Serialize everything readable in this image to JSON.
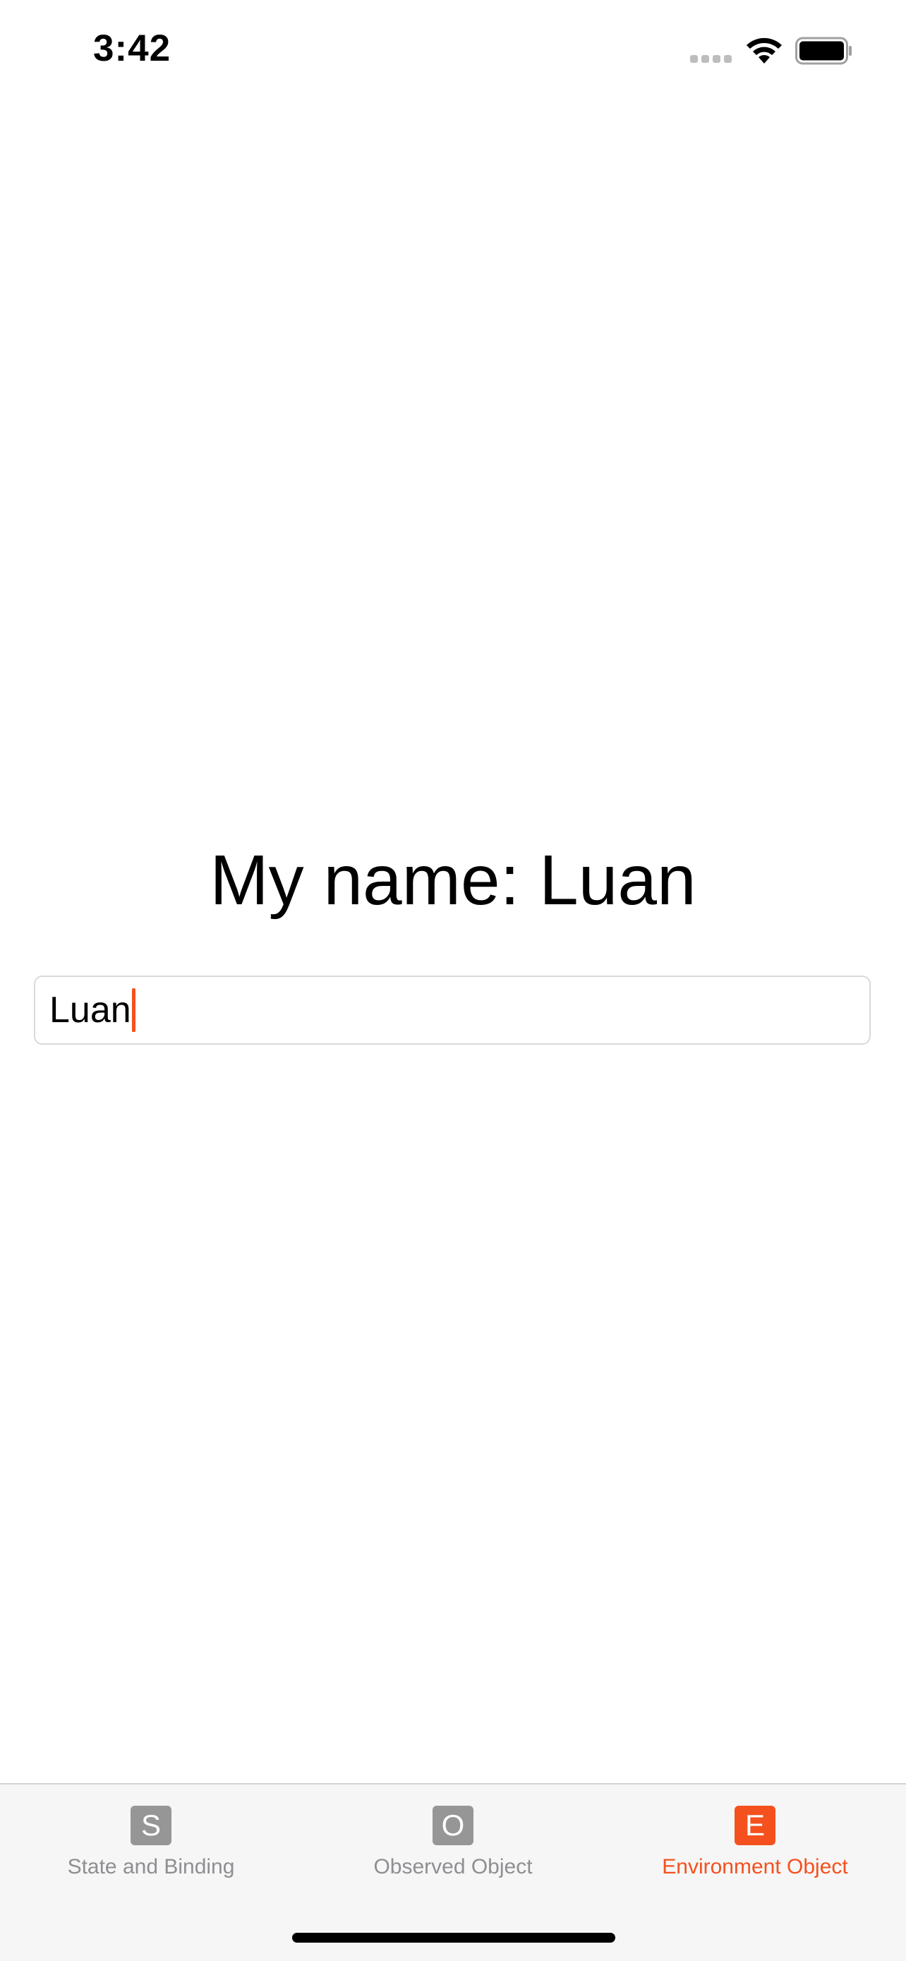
{
  "status_bar": {
    "time": "3:42",
    "icons": [
      "cellular-signal-icon",
      "wifi-icon",
      "battery-icon"
    ]
  },
  "main": {
    "heading": "My name: Luan",
    "name_field": {
      "value": "Luan",
      "placeholder": ""
    }
  },
  "tab_bar": {
    "tabs": [
      {
        "icon_letter": "S",
        "label": "State and Binding",
        "active": false
      },
      {
        "icon_letter": "O",
        "label": "Observed Object",
        "active": false
      },
      {
        "icon_letter": "E",
        "label": "Environment Object",
        "active": true
      }
    ]
  },
  "colors": {
    "accent": "#f4511e",
    "inactive_tab": "#8e8e93",
    "inactive_icon_bg": "#969696",
    "tab_bar_bg": "#f6f6f6"
  }
}
